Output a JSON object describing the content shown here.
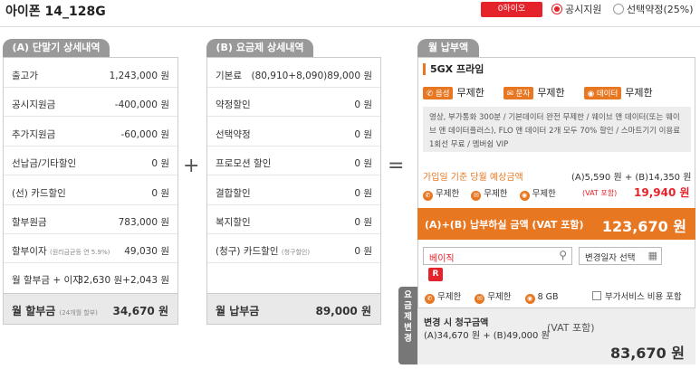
{
  "header": {
    "title": "아이폰 14_128G",
    "zero_button": "0하이오",
    "radio_public": "공시지원",
    "radio_select": "선택약정(25%)"
  },
  "panel_a": {
    "header": "(A) 단말기 상세내역",
    "rows": [
      {
        "label": "출고가",
        "value": "1,243,000 원"
      },
      {
        "label": "공시지원금",
        "value": "-400,000 원"
      },
      {
        "label": "추가지원금",
        "value": "-60,000 원"
      },
      {
        "label": "선납금/기타할인",
        "value": "0 원"
      },
      {
        "label": "(선) 카드할인",
        "value": "0 원"
      },
      {
        "label": "할부원금",
        "value": "783,000 원"
      },
      {
        "label": "할부이자",
        "note": "(원리금균등 연 5.9%)",
        "value": "49,030 원"
      },
      {
        "label": "월 할부금 + 이자",
        "value": "32,630 원+2,043 원"
      }
    ],
    "footer_label": "월 할부금",
    "footer_note": "(24개월 할부)",
    "footer_value": "34,670 원"
  },
  "panel_b": {
    "header": "(B) 요금제 상세내역",
    "rows": [
      {
        "label": "기본료",
        "value": "(80,910+8,090)89,000 원"
      },
      {
        "label": "약정할인",
        "value": "0 원"
      },
      {
        "label": "선택약정",
        "value": "0 원"
      },
      {
        "label": "프로모션 할인",
        "value": "0 원"
      },
      {
        "label": "결합할인",
        "value": "0 원"
      },
      {
        "label": "복지할인",
        "value": "0 원"
      },
      {
        "label": "(청구) 카드할인",
        "note": "(청구할인)",
        "value": "0 원"
      }
    ],
    "footer_label": "월 납부금",
    "footer_value": "89,000 원"
  },
  "operators": {
    "plus": "+",
    "equals": "="
  },
  "right": {
    "tab": "월 납부액",
    "plan_name": "5GX 프라임",
    "voice_badge": "음성",
    "voice_value": "무제한",
    "sms_badge": "문자",
    "sms_value": "무제한",
    "data_badge": "데이터",
    "data_value": "무제한",
    "description": "영상, 부가통화 300분 / 기본데이터 완전 무제한 / 웨이브 앤 데이터(또는 웨이브 앤 데이터플러스), FLO 앤 데이터 2개 모두 70% 할인 / 스마트기기 이용료 1회선 무료 / 멤버쉽 VIP",
    "expected_label": "가입일 기준 당월 예상금액",
    "expected_formula": "(A)5,590 원 + (B)14,350 원",
    "exp_item1": "무제한",
    "exp_item2": "무제한",
    "exp_item3": "무제한",
    "vat_note": "(VAT 포함)",
    "expected_total": "19,940 원",
    "pay_label": "(A)+(B) 납부하실 금액 (VAT 포함)",
    "pay_total": "123,670 원",
    "search_value": "베이직",
    "date_label": "변경일자 선택",
    "r_badge": "R",
    "bottom_item1": "무제한",
    "bottom_item2": "무제한",
    "bottom_item3": "8 GB",
    "addon_label": "부가서비스 비용 포함",
    "sidebar_label": "요금제변경",
    "change_title": "변경 시 청구금액",
    "change_formula": "(A)34,670 원 + (B)49,000 원",
    "change_vat": "(VAT 포함)",
    "change_total": "83,670 원"
  },
  "colors": {
    "accent": "#e87722",
    "red": "#e5232a",
    "gray_tab": "#999999"
  }
}
